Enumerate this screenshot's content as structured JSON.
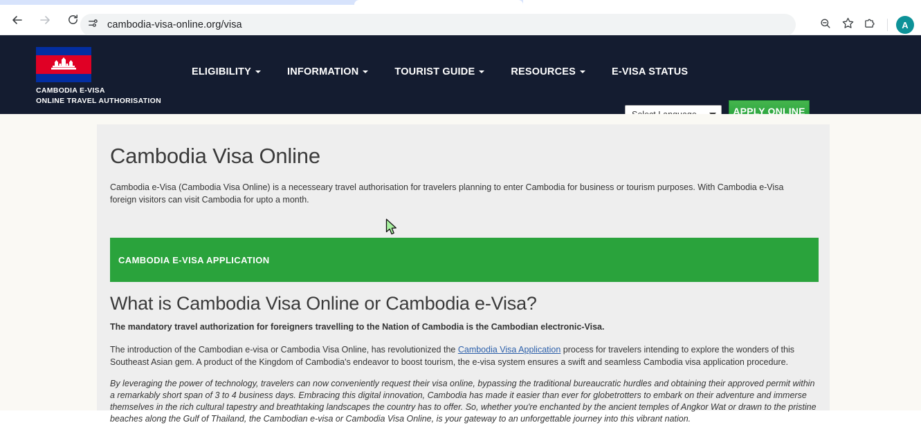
{
  "browser": {
    "back_icon": "arrow-left-icon",
    "forward_icon": "arrow-right-icon",
    "reload_icon": "reload-icon",
    "site_info_icon": "tune-controls-icon",
    "url": "cambodia-visa-online.org/visa",
    "zoom_icon": "zoom-out-icon",
    "bookmark_icon": "star-icon",
    "extensions_icon": "extensions-puzzle-icon",
    "profile_initial": "A"
  },
  "header": {
    "brand_line1": "CAMBODIA E-VISA",
    "brand_line2": "ONLINE TRAVEL AUTHORISATION",
    "flag_alt": "cambodia-flag-icon",
    "nav": [
      {
        "label": "ELIGIBILITY",
        "has_caret": true
      },
      {
        "label": "INFORMATION",
        "has_caret": true
      },
      {
        "label": "TOURIST GUIDE",
        "has_caret": true
      },
      {
        "label": "RESOURCES",
        "has_caret": true
      },
      {
        "label": "E-VISA STATUS",
        "has_caret": false
      }
    ],
    "language_selected": "Select Language",
    "apply_label": "APPLY ONLINE",
    "bg_color": "#141c30",
    "accent_green": "#2aa33c"
  },
  "main": {
    "title": "Cambodia Visa Online",
    "intro": "Cambodia e-Visa (Cambodia Visa Online) is a necesseary travel authorisation for travelers planning to enter Cambodia for business or tourism purposes. With Cambodia e-Visa foreign visitors can visit Cambodia for upto a month.",
    "banner_label": "CAMBODIA E-VISA APPLICATION",
    "section_title": "What is Cambodia Visa Online or Cambodia e-Visa?",
    "lead_bold": "The mandatory travel authorization for foreigners travelling to the Nation of Cambodia is the Cambodian electronic-Visa.",
    "paragraph1_before_link": "The introduction of the Cambodian e-visa or Cambodia Visa Online, has revolutionized the ",
    "paragraph1_link": "Cambodia Visa Application",
    "paragraph1_after_link": " process for travelers intending to explore the wonders of this Southeast Asian gem. A product of the Kingdom of Cambodia's endeavor to boost tourism, the e-visa system ensures a swift and seamless Cambodia visa application procedure.",
    "paragraph2_italic": "By leveraging the power of technology, travelers can now conveniently request their visa online, bypassing the traditional bureaucratic hurdles and obtaining their approved permit within a remarkably short span of 3 to 4 business days. Embracing this digital innovation, Cambodia has made it easier than ever for globetrotters to embark on their adventure and immerse themselves in the rich cultural tapestry and breathtaking landscapes the country has to offer. So, whether you're enchanted by the ancient temples of Angkor Wat or drawn to the pristine beaches along the Gulf of Thailand, the Cambodian e-visa or Cambodia Visa Online, is your gateway to an unforgettable journey into this vibrant nation."
  }
}
